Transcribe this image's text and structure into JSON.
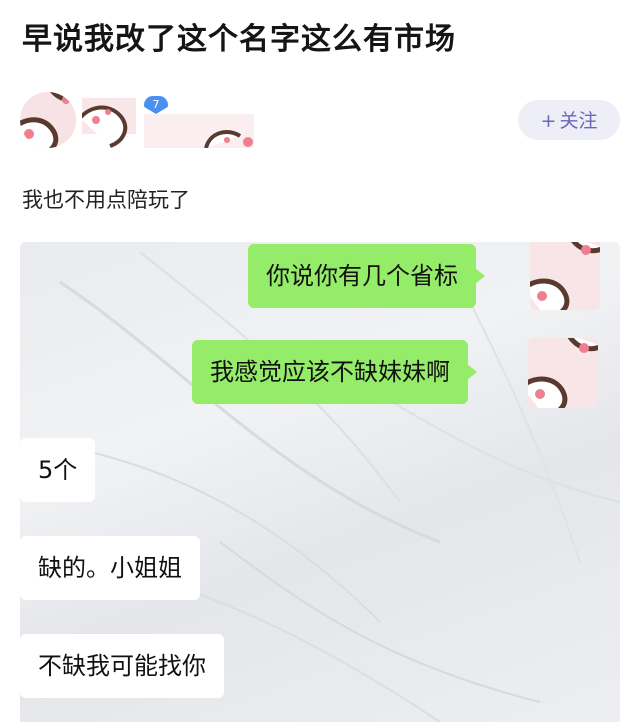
{
  "post": {
    "title": "早说我改了这个名字这么有市场",
    "text": "我也不用点陪玩了"
  },
  "author": {
    "level": "7",
    "follow_label": "关注",
    "follow_plus": "+"
  },
  "chat": {
    "messages": [
      {
        "side": "right",
        "text": "你说你有几个省标"
      },
      {
        "side": "right",
        "text": "我感觉应该不缺妹妹啊"
      },
      {
        "side": "left",
        "text": "5个"
      },
      {
        "side": "left",
        "text": "缺的。小姐姐"
      },
      {
        "side": "left",
        "text": "不缺我可能找你"
      }
    ]
  },
  "colors": {
    "sent_bubble": "#95ec69",
    "received_bubble": "#ffffff",
    "follow_text": "#6b67b8",
    "follow_bg": "#eeeef6",
    "level_badge": "#4a90f0"
  },
  "icons": [
    "paw-avatar-icon",
    "level-diamond-icon",
    "plus-icon"
  ]
}
